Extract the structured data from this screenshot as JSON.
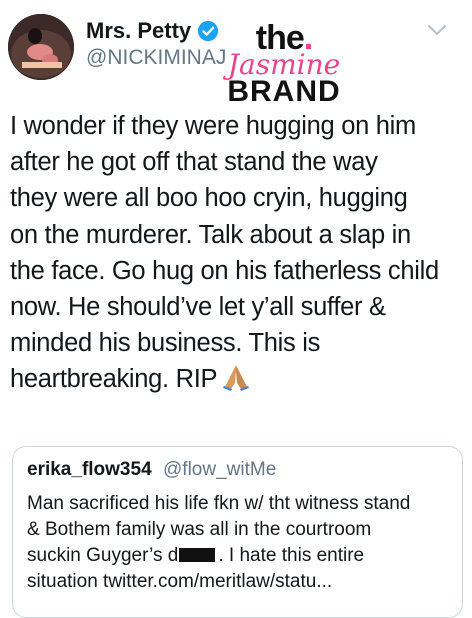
{
  "tweet": {
    "display_name": "Mrs. Petty",
    "handle": "@NICKIMINAJ",
    "verified": true,
    "text_lines": [
      "I wonder if they were hugging on him",
      "after he got off that stand the way",
      "they were all boo hoo cryin, hugging",
      "on the murderer. Talk about a slap in",
      "the face. Go hug on his fatherless child",
      "now. He should’ve let y’all suffer &",
      "minded his business. This is",
      "heartbreaking. RIP"
    ],
    "emoji": "folded-hands"
  },
  "watermark": {
    "the": "the",
    "dot": ".",
    "jasmine": "Jasmine",
    "brand": "BRAND"
  },
  "quoted_tweet": {
    "display_name": "erika_flow354",
    "handle": "@flow_witMe",
    "text_lines": [
      "Man sacrificed his life fkn w/ tht witness stand",
      "& Bothem family was all in the courtroom"
    ],
    "line3_before_redaction": "suckin Guyger’s d",
    "line3_after_redaction": ". I hate this entire",
    "line4": "situation twitter.com/meritlaw/statu..."
  },
  "colors": {
    "text": "#14171a",
    "secondary": "#657786",
    "verified_blue": "#1da1f2",
    "border": "#ccd6dd",
    "watermark_pink": "#e8458b"
  }
}
